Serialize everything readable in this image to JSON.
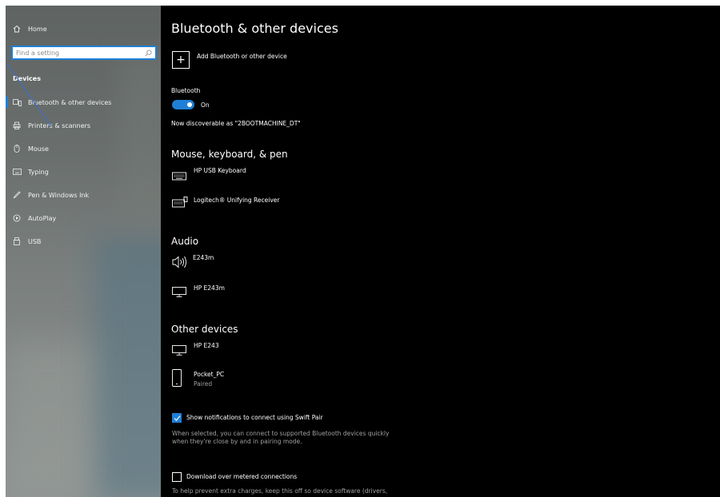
{
  "sidebar": {
    "home_label": "Home",
    "search_placeholder": "Find a setting",
    "section_label": "Devices",
    "items": [
      {
        "label": "Bluetooth & other devices",
        "icon": "bluetooth-devices-icon"
      },
      {
        "label": "Printers & scanners",
        "icon": "printer-icon"
      },
      {
        "label": "Mouse",
        "icon": "mouse-icon"
      },
      {
        "label": "Typing",
        "icon": "keyboard-icon"
      },
      {
        "label": "Pen & Windows Ink",
        "icon": "pen-icon"
      },
      {
        "label": "AutoPlay",
        "icon": "autoplay-icon"
      },
      {
        "label": "USB",
        "icon": "usb-icon"
      }
    ]
  },
  "main": {
    "title": "Bluetooth & other devices",
    "add_device_label": "Add Bluetooth or other device",
    "bluetooth_label": "Bluetooth",
    "bluetooth_state": "On",
    "discoverable_text": "Now discoverable as \"2BOOTMACHINE_DT\"",
    "mouse_section": {
      "title": "Mouse, keyboard, & pen",
      "devices": [
        {
          "name": "HP USB Keyboard",
          "icon": "keyboard-icon"
        },
        {
          "name": "Logitech® Unifying Receiver",
          "icon": "keyboard-icon"
        }
      ]
    },
    "audio_section": {
      "title": "Audio",
      "devices": [
        {
          "name": "E243m",
          "icon": "speaker-icon"
        },
        {
          "name": "HP E243m",
          "icon": "monitor-icon"
        }
      ]
    },
    "other_section": {
      "title": "Other devices",
      "devices": [
        {
          "name": "HP E243",
          "icon": "monitor-icon"
        },
        {
          "name": "Pocket_PC",
          "status": "Paired",
          "icon": "phone-icon"
        }
      ]
    },
    "swift_pair": {
      "label": "Show notifications to connect using Swift Pair",
      "checked": true,
      "description_line1": "When selected, you can connect to supported Bluetooth devices quickly",
      "description_line2": "when they're close by and in pairing mode."
    },
    "metered": {
      "label": "Download over metered connections",
      "checked": false,
      "description": "To help prevent extra charges, keep this off so device software (drivers,"
    }
  },
  "colors": {
    "accent": "#1f7fd6",
    "content_bg": "#000000"
  }
}
